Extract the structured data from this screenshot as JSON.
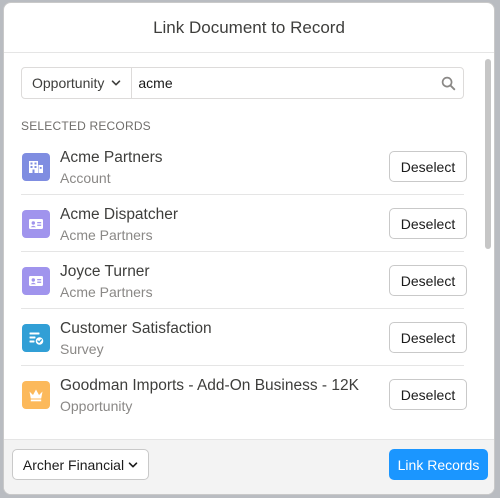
{
  "modal": {
    "title": "Link Document to Record"
  },
  "search": {
    "object_type": "Opportunity",
    "query": "acme",
    "chevron_icon": "chevron-down-icon",
    "search_icon": "search-icon"
  },
  "selected": {
    "label": "SELECTED RECORDS",
    "records": [
      {
        "title": "Acme Partners",
        "subtitle": "Account",
        "icon": "account-icon",
        "icon_color": "#7f8de1",
        "action": "Deselect"
      },
      {
        "title": "Acme Dispatcher",
        "subtitle": "Acme Partners",
        "icon": "contact-icon",
        "icon_color": "#a094ed",
        "action": "Deselect"
      },
      {
        "title": "Joyce Turner",
        "subtitle": "Acme Partners",
        "icon": "contact-icon",
        "icon_color": "#a094ed",
        "action": "Deselect"
      },
      {
        "title": "Customer Satisfaction",
        "subtitle": "Survey",
        "icon": "survey-icon",
        "icon_color": "#319fd6",
        "action": "Deselect"
      },
      {
        "title": "Goodman Imports - Add-On Business - 12K",
        "subtitle": "Opportunity",
        "icon": "opportunity-icon",
        "icon_color": "#fcb95b",
        "action": "Deselect"
      }
    ]
  },
  "footer": {
    "org": "Archer Financial",
    "primary_action": "Link Records",
    "primary_color": "#1b96ff"
  }
}
